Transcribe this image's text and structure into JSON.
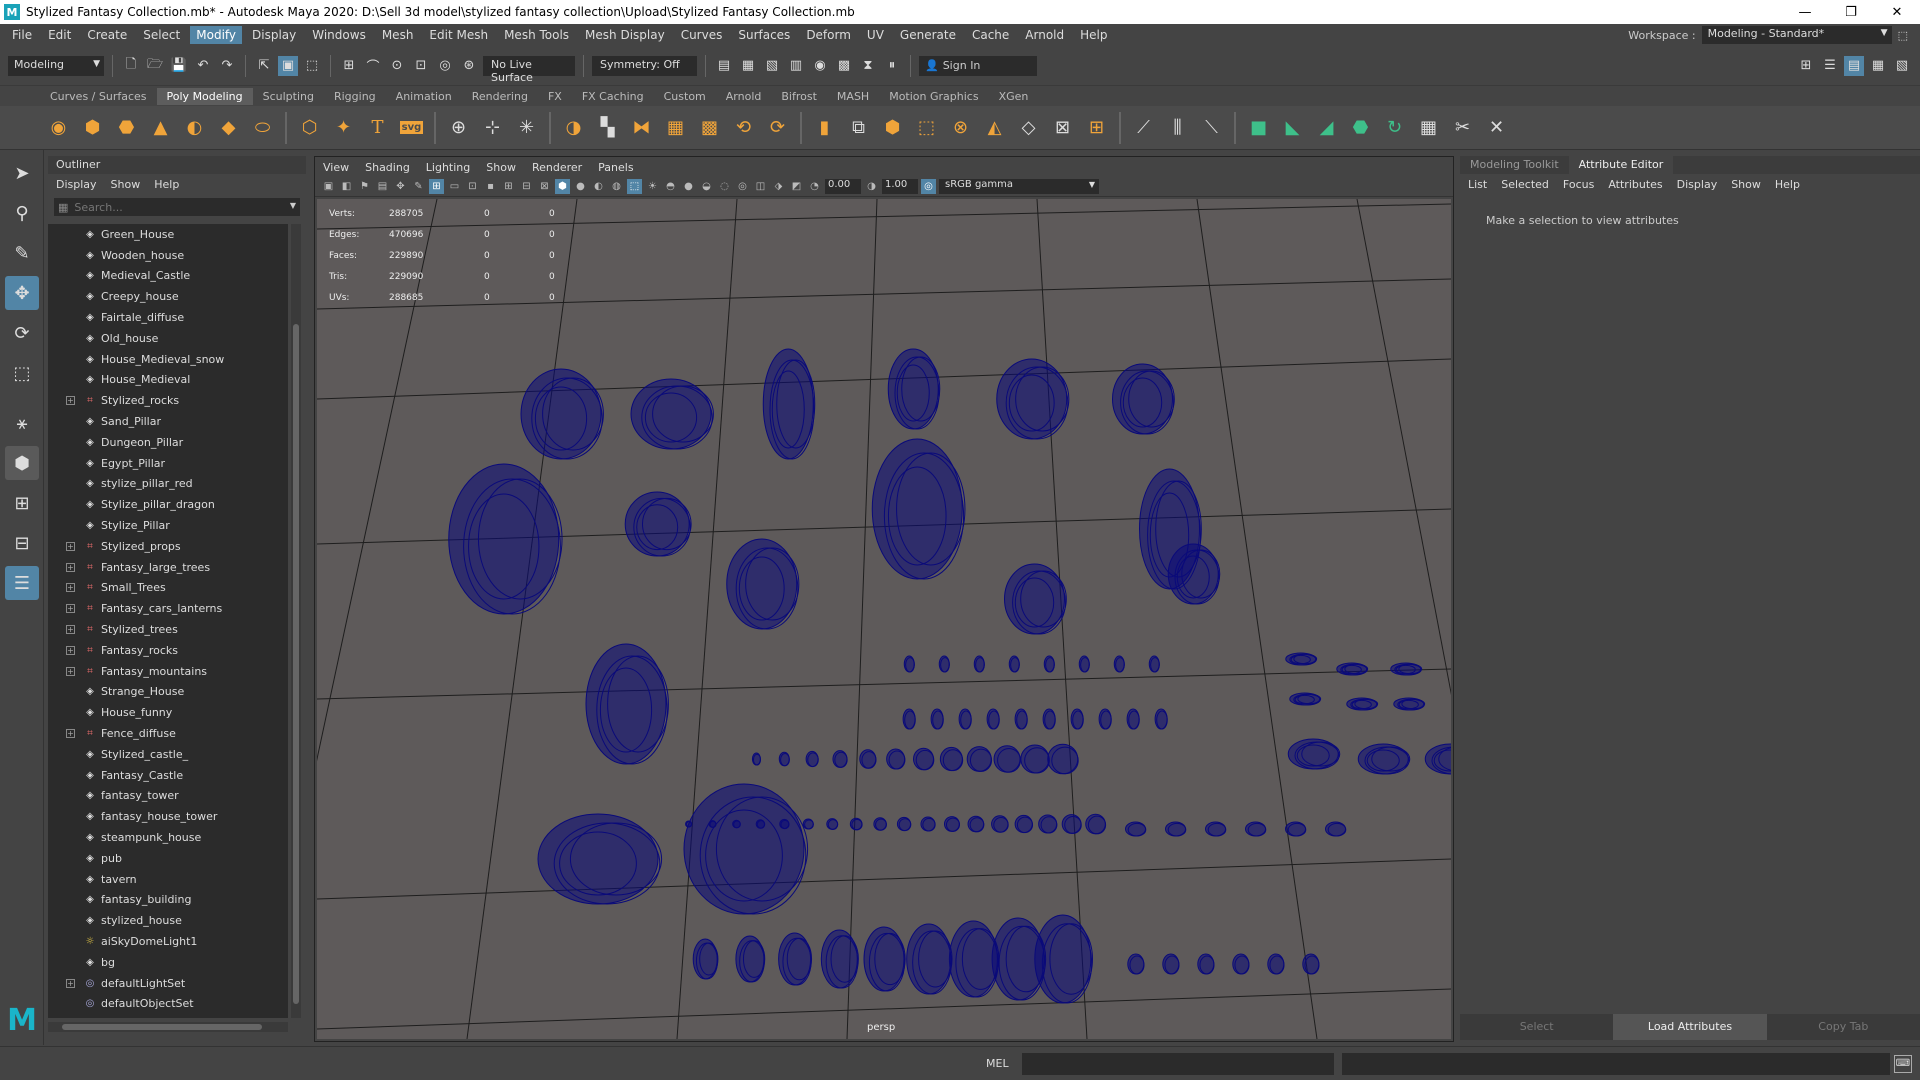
{
  "window": {
    "title": "Stylized Fantasy Collection.mb* - Autodesk Maya 2020: D:\\Sell 3d model\\stylized fantasy collection\\Upload\\Stylized Fantasy Collection.mb",
    "logo": "M",
    "minimize": "—",
    "restore": "❐",
    "close": "✕"
  },
  "menubar": {
    "items": [
      "File",
      "Edit",
      "Create",
      "Select",
      "Modify",
      "Display",
      "Windows",
      "Mesh",
      "Edit Mesh",
      "Mesh Tools",
      "Mesh Display",
      "Curves",
      "Surfaces",
      "Deform",
      "UV",
      "Generate",
      "Cache",
      "Arnold",
      "Help"
    ],
    "active": "Modify",
    "workspace_label": "Workspace :",
    "workspace_value": "Modeling - Standard*"
  },
  "statusline": {
    "mode": "Modeling",
    "live_surface": "No Live Surface",
    "symmetry": "Symmetry: Off",
    "sign_in": "Sign In"
  },
  "shelf": {
    "tabs": [
      "Curves / Surfaces",
      "Poly Modeling",
      "Sculpting",
      "Rigging",
      "Animation",
      "Rendering",
      "FX",
      "FX Caching",
      "Custom",
      "Arnold",
      "Bifrost",
      "MASH",
      "Motion Graphics",
      "XGen"
    ],
    "active_tab": "Poly Modeling",
    "svg_label": "svg",
    "text_label": "T"
  },
  "outliner": {
    "title": "Outliner",
    "menu": [
      "Display",
      "Show",
      "Help"
    ],
    "search_placeholder": "Search...",
    "items": [
      {
        "name": "Green_House",
        "type": "mesh",
        "expandable": false
      },
      {
        "name": "Wooden_house",
        "type": "mesh",
        "expandable": false
      },
      {
        "name": "Medieval_Castle",
        "type": "mesh",
        "expandable": false
      },
      {
        "name": "Creepy_house",
        "type": "mesh",
        "expandable": false
      },
      {
        "name": "Fairtale_diffuse",
        "type": "mesh",
        "expandable": false
      },
      {
        "name": "Old_house",
        "type": "mesh",
        "expandable": false
      },
      {
        "name": "House_Medieval_snow",
        "type": "mesh",
        "expandable": false
      },
      {
        "name": "House_Medieval",
        "type": "mesh",
        "expandable": false
      },
      {
        "name": "Stylized_rocks",
        "type": "group",
        "expandable": true
      },
      {
        "name": "Sand_Pillar",
        "type": "mesh",
        "expandable": false
      },
      {
        "name": "Dungeon_Pillar",
        "type": "mesh",
        "expandable": false
      },
      {
        "name": "Egypt_Pillar",
        "type": "mesh",
        "expandable": false
      },
      {
        "name": "stylize_pillar_red",
        "type": "mesh",
        "expandable": false
      },
      {
        "name": "Stylize_pillar_dragon",
        "type": "mesh",
        "expandable": false
      },
      {
        "name": "Stylize_Pillar",
        "type": "mesh",
        "expandable": false
      },
      {
        "name": "Stylized_props",
        "type": "group",
        "expandable": true
      },
      {
        "name": "Fantasy_large_trees",
        "type": "group",
        "expandable": true
      },
      {
        "name": "Small_Trees",
        "type": "group",
        "expandable": true
      },
      {
        "name": "Fantasy_cars_lanterns",
        "type": "group",
        "expandable": true
      },
      {
        "name": "Stylized_trees",
        "type": "group",
        "expandable": true
      },
      {
        "name": "Fantasy_rocks",
        "type": "group",
        "expandable": true
      },
      {
        "name": "Fantasy_mountains",
        "type": "group",
        "expandable": true
      },
      {
        "name": "Strange_House",
        "type": "mesh",
        "expandable": false
      },
      {
        "name": "House_funny",
        "type": "mesh",
        "expandable": false
      },
      {
        "name": "Fence_diffuse",
        "type": "group",
        "expandable": true
      },
      {
        "name": "Stylized_castle_",
        "type": "mesh",
        "expandable": false
      },
      {
        "name": "Fantasy_Castle",
        "type": "mesh",
        "expandable": false
      },
      {
        "name": "fantasy_tower",
        "type": "mesh",
        "expandable": false
      },
      {
        "name": "fantasy_house_tower",
        "type": "mesh",
        "expandable": false
      },
      {
        "name": "steampunk_house",
        "type": "mesh",
        "expandable": false
      },
      {
        "name": "pub",
        "type": "mesh",
        "expandable": false
      },
      {
        "name": "tavern",
        "type": "mesh",
        "expandable": false
      },
      {
        "name": "fantasy_building",
        "type": "mesh",
        "expandable": false
      },
      {
        "name": "stylized_house",
        "type": "mesh",
        "expandable": false
      },
      {
        "name": "aiSkyDomeLight1",
        "type": "light",
        "expandable": false
      },
      {
        "name": "bg",
        "type": "mesh",
        "expandable": false
      },
      {
        "name": "defaultLightSet",
        "type": "set",
        "expandable": true
      },
      {
        "name": "defaultObjectSet",
        "type": "set",
        "expandable": false
      }
    ]
  },
  "viewport": {
    "menu": [
      "View",
      "Shading",
      "Lighting",
      "Show",
      "Renderer",
      "Panels"
    ],
    "exposure": "0.00",
    "gamma": "1.00",
    "color_space": "sRGB gamma",
    "camera": "persp",
    "hud": [
      {
        "label": "Verts:",
        "v1": "288705",
        "v2": "0",
        "v3": "0"
      },
      {
        "label": "Edges:",
        "v1": "470696",
        "v2": "0",
        "v3": "0"
      },
      {
        "label": "Faces:",
        "v1": "229890",
        "v2": "0",
        "v3": "0"
      },
      {
        "label": "Tris:",
        "v1": "229090",
        "v2": "0",
        "v3": "0"
      },
      {
        "label": "UVs:",
        "v1": "288685",
        "v2": "0",
        "v3": "0"
      }
    ]
  },
  "attribute_editor": {
    "tabs": [
      "Modeling Toolkit",
      "Attribute Editor"
    ],
    "active_tab": "Attribute Editor",
    "menu": [
      "List",
      "Selected",
      "Focus",
      "Attributes",
      "Display",
      "Show",
      "Help"
    ],
    "message": "Make a selection to view attributes",
    "buttons": [
      "Select",
      "Load Attributes",
      "Copy Tab"
    ]
  },
  "command_line": {
    "label": "MEL"
  },
  "colors": {
    "accent": "#5285a6",
    "wireframe": "#0a0a7a",
    "grid": "#1e1e1e",
    "viewport_bg": "#5e5a5a"
  }
}
